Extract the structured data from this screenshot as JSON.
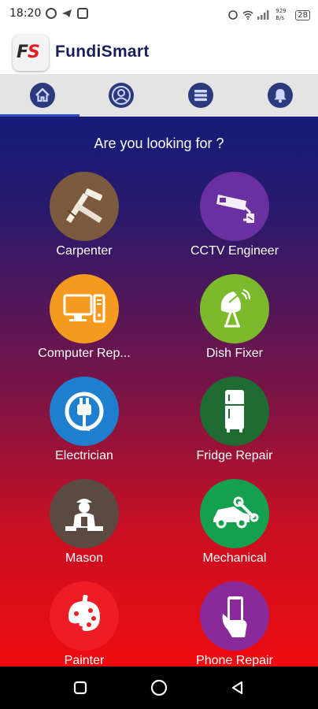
{
  "status_bar": {
    "time": "18:20",
    "net_speed": "929 B/s",
    "battery": "28"
  },
  "app": {
    "logo_f": "F",
    "logo_s": "S",
    "title": "FundiSmart"
  },
  "tabs": [
    {
      "name": "home",
      "icon": "home-icon",
      "selected": true
    },
    {
      "name": "profile",
      "icon": "user-icon",
      "selected": false
    },
    {
      "name": "list",
      "icon": "list-icon",
      "selected": false
    },
    {
      "name": "notifications",
      "icon": "bell-icon",
      "selected": false
    }
  ],
  "main": {
    "heading": "Are you looking for ?",
    "services": [
      {
        "label": "Carpenter",
        "icon": "carpenter-tools-icon",
        "color": "#7b5a3d"
      },
      {
        "label": "CCTV Engineer",
        "icon": "cctv-camera-icon",
        "color": "#6a2fa0"
      },
      {
        "label": "Computer Rep...",
        "icon": "computer-icon",
        "color": "#f39a1f"
      },
      {
        "label": "Dish Fixer",
        "icon": "satellite-dish-icon",
        "color": "#7cba2b"
      },
      {
        "label": "Electrician",
        "icon": "plug-icon",
        "color": "#1f7fcf"
      },
      {
        "label": "Fridge Repair",
        "icon": "fridge-icon",
        "color": "#1f6b34"
      },
      {
        "label": "Mason",
        "icon": "mason-worker-icon",
        "color": "#5a4a42"
      },
      {
        "label": "Mechanical",
        "icon": "car-wrench-icon",
        "color": "#15a050"
      },
      {
        "label": "Painter",
        "icon": "paint-palette-icon",
        "color": "#ee1d25"
      },
      {
        "label": "Phone Repair",
        "icon": "phone-hand-icon",
        "color": "#8a2a9a"
      }
    ]
  },
  "nav": {
    "buttons": [
      {
        "name": "recent-apps",
        "icon": "square-icon"
      },
      {
        "name": "home",
        "icon": "circle-icon"
      },
      {
        "name": "back",
        "icon": "triangle-back-icon"
      }
    ]
  }
}
